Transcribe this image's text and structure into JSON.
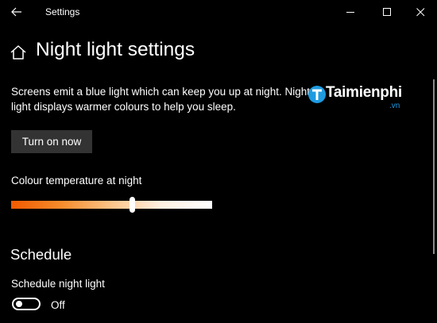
{
  "window": {
    "title": "Settings",
    "back_icon": "arrow-left-icon",
    "controls": [
      "minimize-icon",
      "maximize-icon",
      "close-icon"
    ]
  },
  "page": {
    "home_icon": "home-icon",
    "title": "Night light settings",
    "description": "Screens emit a blue light which can keep you up at night. Night light displays warmer colours to help you sleep."
  },
  "watermark": {
    "brand": "Taimienphi",
    "domain": ".vn",
    "color": "#1e9be0"
  },
  "turn_on_button": {
    "label": "Turn on now"
  },
  "colour_temperature": {
    "label": "Colour temperature at night",
    "value_percent": 60,
    "gradient_colors": [
      "#f15a00",
      "#f58c2c",
      "#fcc48a",
      "#fff1e2",
      "#ffffff"
    ]
  },
  "schedule": {
    "heading": "Schedule",
    "label": "Schedule night light",
    "toggle_state": "Off",
    "enabled": false
  },
  "colors": {
    "background": "#000000",
    "text": "#ffffff",
    "button_bg": "#333333"
  }
}
